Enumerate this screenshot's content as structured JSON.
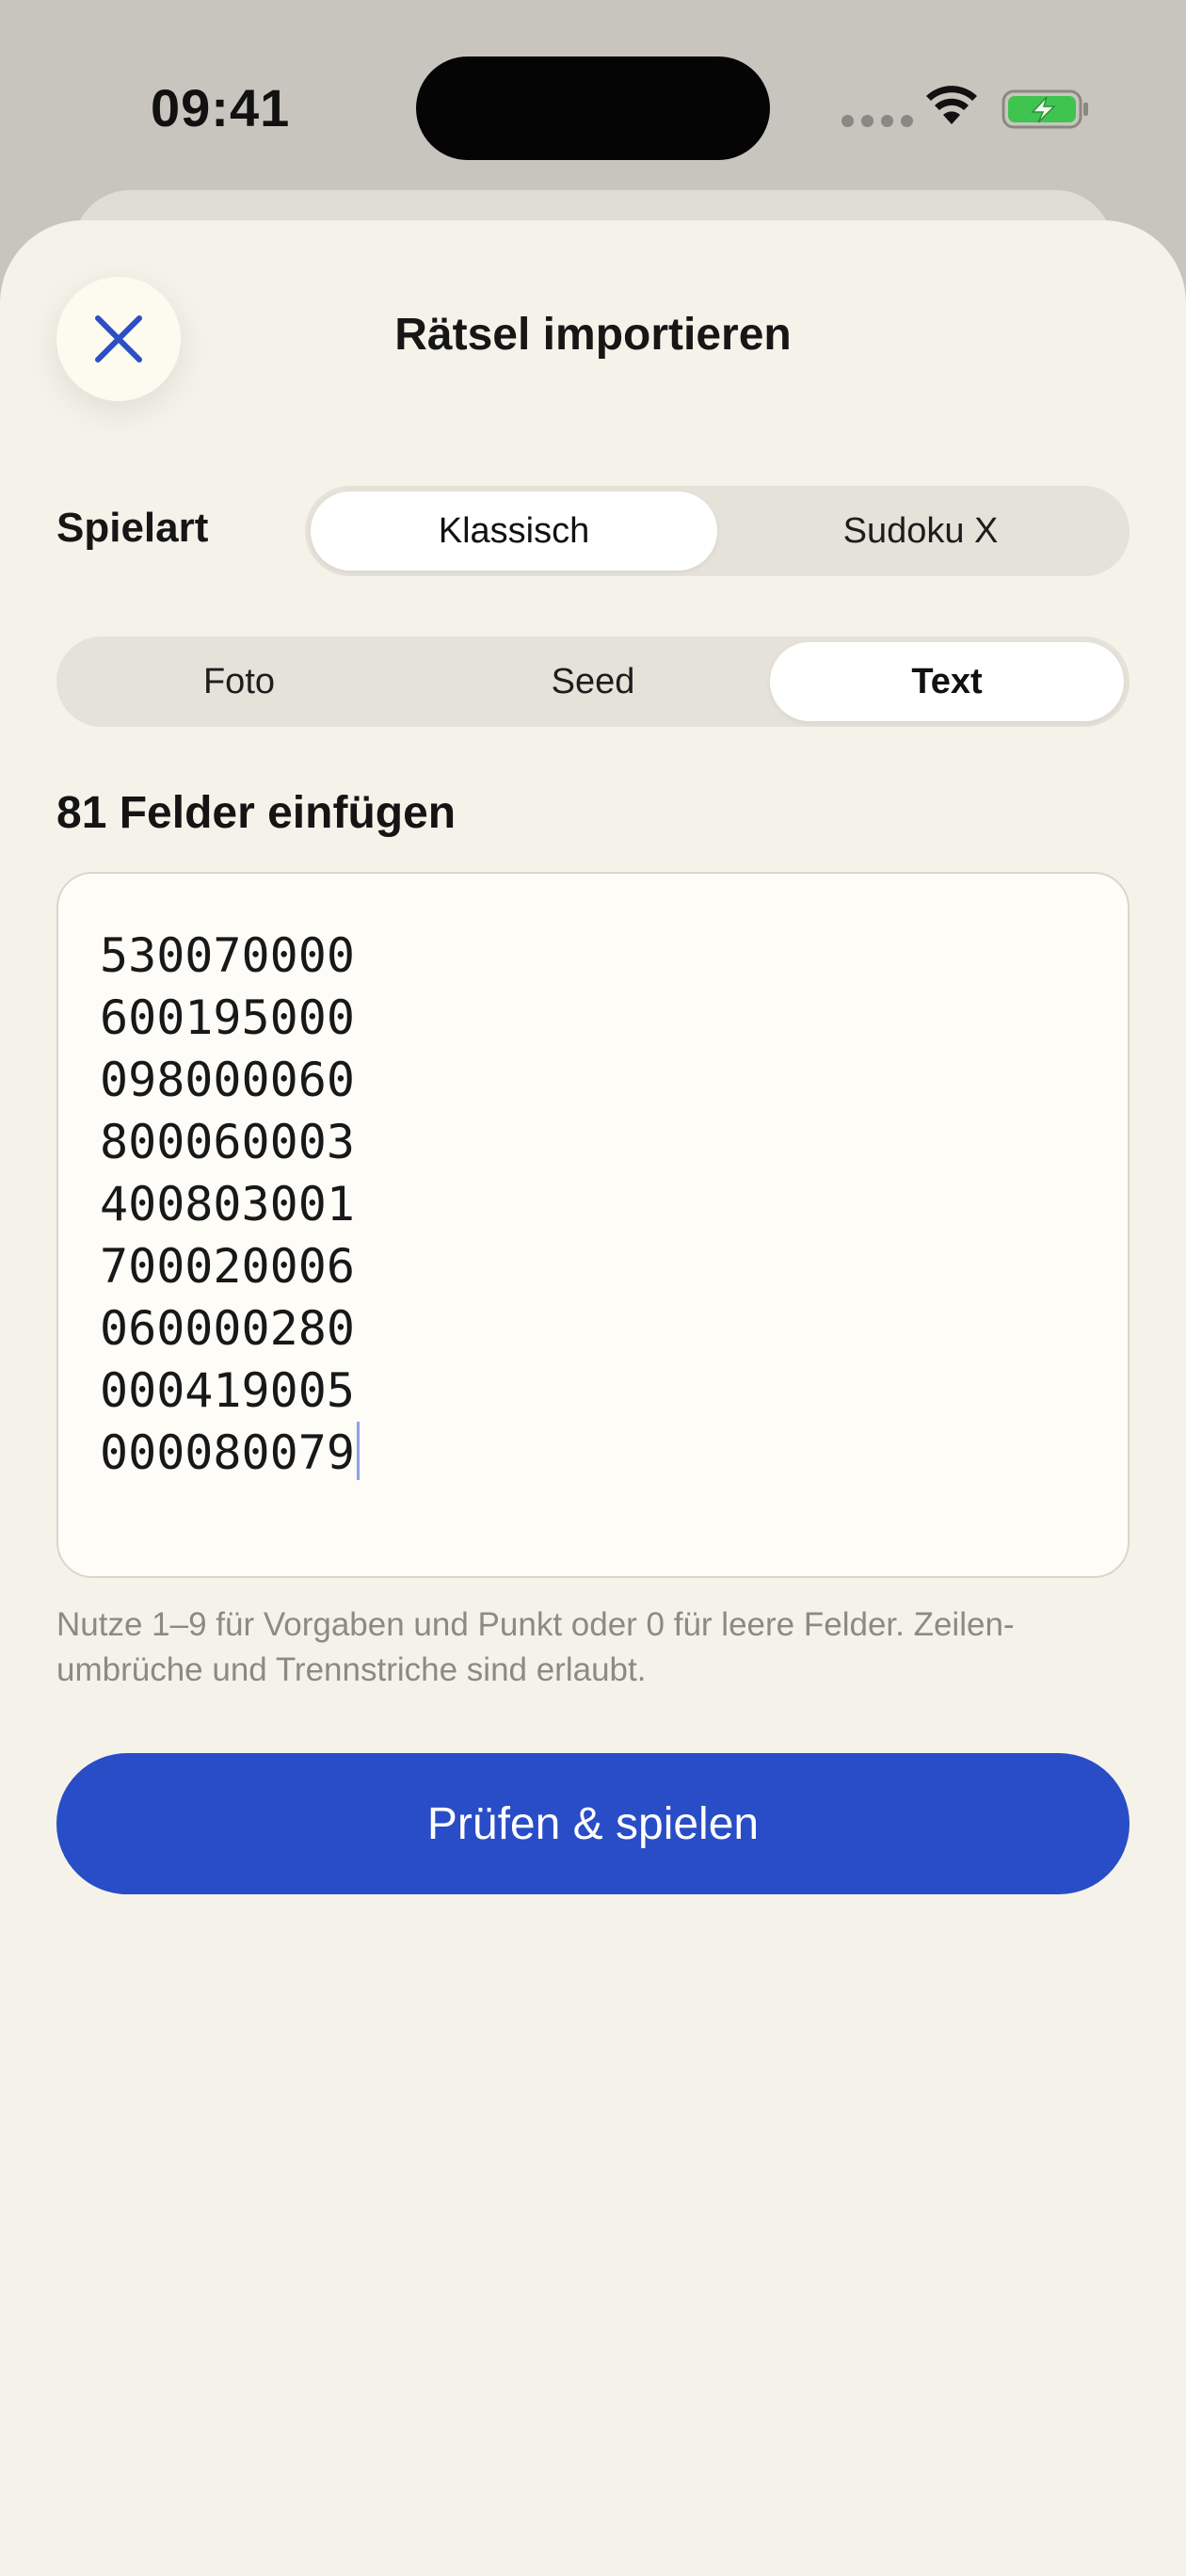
{
  "status_bar": {
    "time": "09:41",
    "icons": [
      "signal-dots-icon",
      "wifi-icon",
      "battery-charging-icon"
    ],
    "battery_color": "#3fc450"
  },
  "header": {
    "close_icon": "close-icon",
    "title": "Rätsel importieren"
  },
  "game_mode": {
    "label": "Spielart",
    "options": [
      "Klassisch",
      "Sudoku X"
    ],
    "selected": "Klassisch"
  },
  "source_tabs": {
    "options": [
      "Foto",
      "Seed",
      "Text"
    ],
    "selected": "Text"
  },
  "input": {
    "heading": "81 Felder einfügen",
    "lines": [
      "530070000",
      "600195000",
      "098000060",
      "800060003",
      "400803001",
      "700020006",
      "060000280",
      "000419005",
      "000080079"
    ],
    "hint": "Nutze 1–9 für Vorgaben und Punkt oder 0 für leere Felder. Zeilen-umbrüche und Trennstriche sind erlaubt."
  },
  "primary_action": {
    "label": "Prüfen & spielen"
  },
  "colors": {
    "accent": "#294dc7",
    "sheet_background": "#f5f2ea",
    "backdrop": "#c8c5be"
  }
}
